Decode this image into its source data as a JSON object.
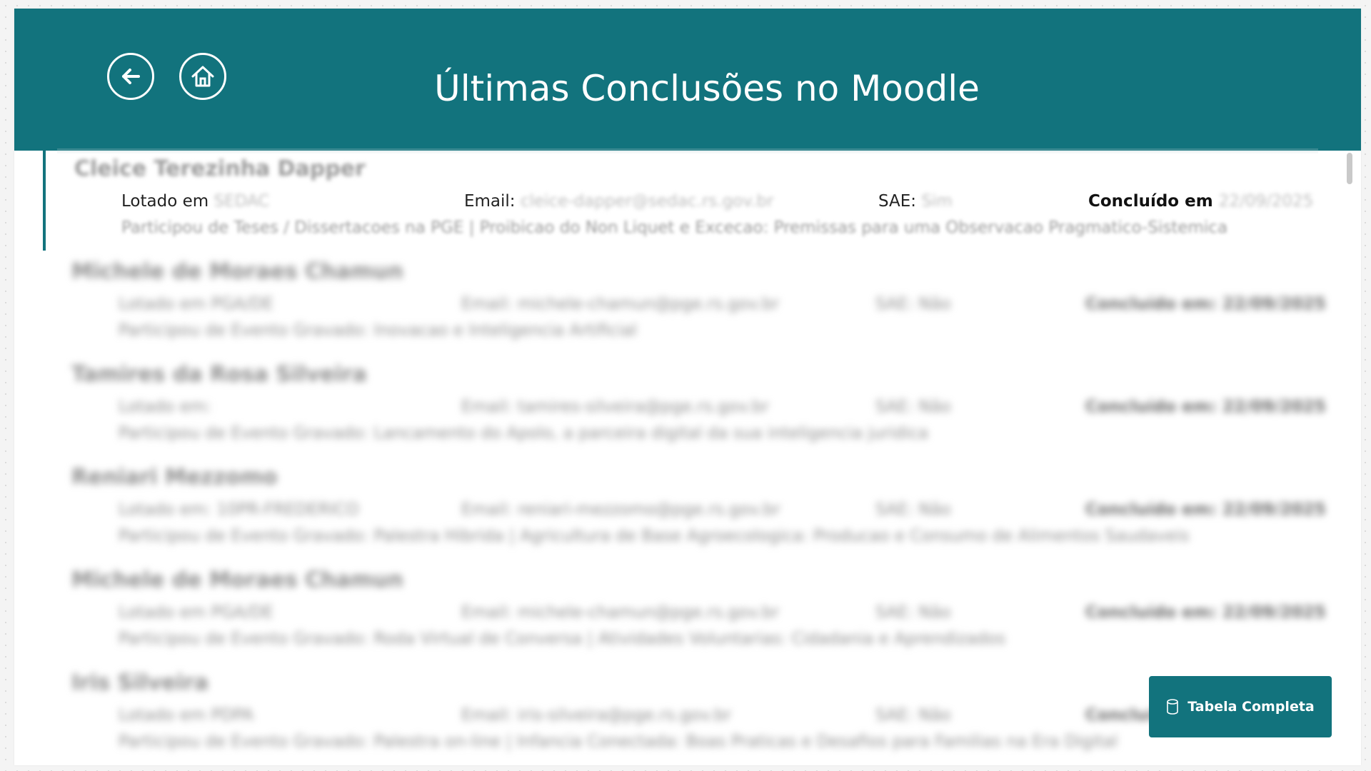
{
  "header": {
    "title": "Últimas Conclusões no Moodle",
    "back_icon": "arrow-left-icon",
    "home_icon": "home-icon",
    "color": "#12737d"
  },
  "entries": [
    {
      "name": "Cleice Terezinha Dapper",
      "lotado_label": "Lotado em",
      "lotado_value": "SEDAC",
      "email_label": "Email:",
      "email_value": "cleice-dapper@sedac.rs.gov.br",
      "sae_label": "SAE:",
      "sae_value": "Sim",
      "concluido_label": "Concluído em",
      "concluido_value": "22/09/2025",
      "participou": "Participou de Teses / Dissertacoes na PGE | Proibicao do Non Liquet e Excecao: Premissas para uma Observacao Pragmatico-Sistemica"
    },
    {
      "name": "Michele de Moraes Chamun",
      "lotado_label": "Lotado em",
      "lotado_value": "PGA/DE",
      "email_label": "Email:",
      "email_value": "michele-chamun@pge.rs.gov.br",
      "sae_label": "SAE:",
      "sae_value": "Não",
      "concluido_label": "Concluído em:",
      "concluido_value": "22/09/2025",
      "participou": "Participou de Evento Gravado: Inovacao e Inteligencia Artificial"
    },
    {
      "name": "Tamires da Rosa Silveira",
      "lotado_label": "Lotado em:",
      "lotado_value": "",
      "email_label": "Email:",
      "email_value": "tamires-silveira@pge.rs.gov.br",
      "sae_label": "SAE:",
      "sae_value": "Não",
      "concluido_label": "Concluído em:",
      "concluido_value": "22/09/2025",
      "participou": "Participou de Evento Gravado: Lancamento do Apolo, a parceira digital da sua inteligencia juridica"
    },
    {
      "name": "Reniari Mezzomo",
      "lotado_label": "Lotado em:",
      "lotado_value": "10PR-FREDERICO",
      "email_label": "Email:",
      "email_value": "reniari-mezzomo@pge.rs.gov.br",
      "sae_label": "SAE:",
      "sae_value": "Não",
      "concluido_label": "Concluído em:",
      "concluido_value": "22/09/2025",
      "participou": "Participou de Evento Gravado: Palestra Hibrida | Agricultura de Base Agroecologica: Producao e Consumo de Alimentos Saudaveis"
    },
    {
      "name": "Michele de Moraes Chamun",
      "lotado_label": "Lotado em",
      "lotado_value": "PGA/DE",
      "email_label": "Email:",
      "email_value": "michele-chamun@pge.rs.gov.br",
      "sae_label": "SAE:",
      "sae_value": "Não",
      "concluido_label": "Concluído em:",
      "concluido_value": "22/09/2025",
      "participou": "Participou de Evento Gravado: Roda Virtual de Conversa | Atividades Voluntarias: Cidadania e Aprendizados"
    },
    {
      "name": "Iris Silveira",
      "lotado_label": "Lotado em",
      "lotado_value": "PDPA",
      "email_label": "Email:",
      "email_value": "iris-silveira@pge.rs.gov.br",
      "sae_label": "SAE:",
      "sae_value": "Não",
      "concluido_label": "Concluído em:",
      "concluido_value": "",
      "participou": "Participou de Evento Gravado: Palestra on-line | Infancia Conectada: Boas Praticas e Desafios para Familias na Era Digital"
    }
  ],
  "footer_button": {
    "label": "Tabela Completa",
    "icon": "database-icon"
  }
}
